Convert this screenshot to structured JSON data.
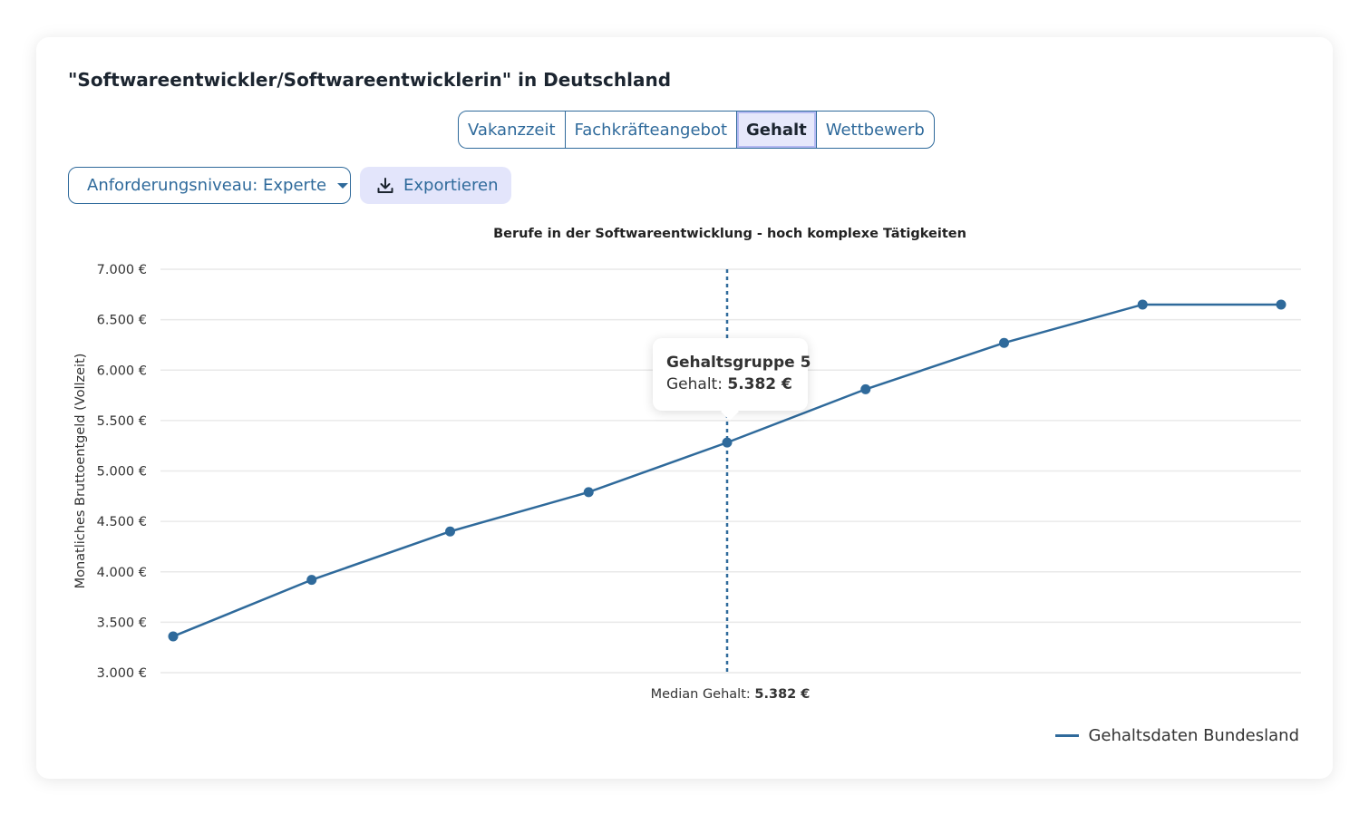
{
  "header": {
    "title": "\"Softwareentwickler/Softwareentwicklerin\" in Deutschland"
  },
  "tabs": [
    {
      "label": "Vakanzzeit",
      "active": false
    },
    {
      "label": "Fachkräfteangebot",
      "active": false
    },
    {
      "label": "Gehalt",
      "active": true
    },
    {
      "label": "Wettbewerb",
      "active": false
    }
  ],
  "controls": {
    "level_select_label": "Anforderungsniveau: Experte",
    "export_label": "Exportieren",
    "export_icon": "download-icon",
    "dropdown_icon": "caret-down-icon"
  },
  "colors": {
    "accent": "#2f6a9b",
    "tab_active_bg": "#e6e8fb",
    "export_bg": "#e3e5fb"
  },
  "tooltip": {
    "title": "Gehaltsgruppe 5",
    "value_prefix": "Gehalt: ",
    "value": "5.382 €"
  },
  "median": {
    "prefix": "Median Gehalt: ",
    "value": "5.382 €"
  },
  "chart_data": {
    "type": "line",
    "title": "Berufe in der Softwareentwicklung - hoch komplexe Tätigkeiten",
    "ylabel": "Monatliches Bruttoentgeld (Vollzeit)",
    "xlabel": "",
    "ylim": [
      3000,
      7000
    ],
    "yticks": [
      7000,
      6500,
      6000,
      5500,
      5000,
      4500,
      4000,
      3500,
      3000
    ],
    "ytick_labels": [
      "7.000 €",
      "6.500 €",
      "6.000 €",
      "5.500 €",
      "5.000 €",
      "4.500 €",
      "4.000 €",
      "3.500 €",
      "3.000 €"
    ],
    "x": [
      1,
      2,
      3,
      4,
      5,
      6,
      7,
      8,
      9
    ],
    "series": [
      {
        "name": "Gehaltsdaten Bundesland",
        "color": "#2f6a9b",
        "values": [
          3360,
          3920,
          4400,
          4790,
          5282,
          5810,
          6270,
          6650,
          6650
        ]
      }
    ],
    "median_x": 5,
    "grid": true,
    "legend_position": "bottom-right"
  }
}
